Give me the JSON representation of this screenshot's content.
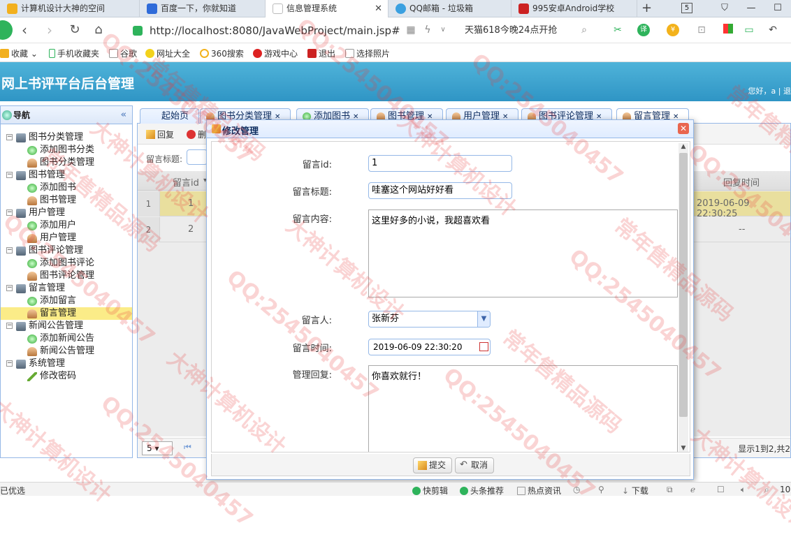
{
  "browser": {
    "tabs": [
      {
        "label": "计算机设计大神的空间",
        "color": "#f2b01e"
      },
      {
        "label": "百度一下，你就知道",
        "color": "#2f6bd9"
      },
      {
        "label": "信息管理系统",
        "color": "#bbbbbb",
        "close": "✕"
      },
      {
        "label": "QQ邮箱 - 垃圾箱",
        "color": "#3aa0e0"
      },
      {
        "label": "995安卓Android学校",
        "color": "#cc2222"
      }
    ],
    "new_tab": "+",
    "tab_count": "5",
    "url": "http://localhost:8080/JavaWebProject/main.jsp#",
    "promo": "天猫618今晚24点开抢",
    "bookmarks": [
      "收藏",
      "手机收藏夹",
      "谷歌",
      "网址大全",
      "360搜索",
      "游戏中心",
      "退出",
      "选择照片"
    ]
  },
  "app": {
    "title": "网上书评平台后台管理",
    "welcome": "您好，a | 退"
  },
  "nav": {
    "title": "导航",
    "collapse": "«",
    "tree": [
      {
        "label": "图书分类管理",
        "level": 0,
        "icon": "folder"
      },
      {
        "label": "添加图书分类",
        "level": 1,
        "icon": "add"
      },
      {
        "label": "图书分类管理",
        "level": 1,
        "icon": "user"
      },
      {
        "label": "图书管理",
        "level": 0,
        "icon": "folder"
      },
      {
        "label": "添加图书",
        "level": 1,
        "icon": "add"
      },
      {
        "label": "图书管理",
        "level": 1,
        "icon": "user"
      },
      {
        "label": "用户管理",
        "level": 0,
        "icon": "folder"
      },
      {
        "label": "添加用户",
        "level": 1,
        "icon": "add"
      },
      {
        "label": "用户管理",
        "level": 1,
        "icon": "user"
      },
      {
        "label": "图书评论管理",
        "level": 0,
        "icon": "folder"
      },
      {
        "label": "添加图书评论",
        "level": 1,
        "icon": "add"
      },
      {
        "label": "图书评论管理",
        "level": 1,
        "icon": "user"
      },
      {
        "label": "留言管理",
        "level": 0,
        "icon": "folder"
      },
      {
        "label": "添加留言",
        "level": 1,
        "icon": "add"
      },
      {
        "label": "留言管理",
        "level": 1,
        "icon": "user",
        "selected": true
      },
      {
        "label": "新闻公告管理",
        "level": 0,
        "icon": "folder"
      },
      {
        "label": "添加新闻公告",
        "level": 1,
        "icon": "add"
      },
      {
        "label": "新闻公告管理",
        "level": 1,
        "icon": "user"
      },
      {
        "label": "系统管理",
        "level": 0,
        "icon": "folder"
      },
      {
        "label": "修改密码",
        "level": 1,
        "icon": "pen"
      }
    ]
  },
  "main_tabs": [
    "起始页",
    "图书分类管理",
    "添加图书",
    "图书管理",
    "用户管理",
    "图书评论管理",
    "留言管理"
  ],
  "grid": {
    "toolbar": {
      "reply": "回复",
      "delete": "删"
    },
    "search_label": "留言标题:",
    "headers": {
      "id": "留言id",
      "reply_time": "回复时间"
    },
    "rows": [
      {
        "num": "1",
        "id": "1",
        "reply_time": "2019-06-09 22:30:25",
        "selected": true
      },
      {
        "num": "2",
        "id": "2",
        "reply_time": "--"
      }
    ],
    "page_size": "5",
    "page_info": "显示1到2,共2"
  },
  "modal": {
    "title": "修改管理",
    "close": "✕",
    "fields": {
      "id_label": "留言id:",
      "id_value": "1",
      "title_label": "留言标题:",
      "title_value": "哇塞这个网站好好看",
      "content_label": "留言内容:",
      "content_value": "这里好多的小说，我超喜欢看",
      "person_label": "留言人:",
      "person_value": "张新芬",
      "time_label": "留言时间:",
      "time_value": "2019-06-09 22:30:20",
      "reply_label": "管理回复:",
      "reply_value": "你喜欢就行！"
    },
    "submit": "提交",
    "cancel": "取消"
  },
  "statusbar": {
    "left": "已优选",
    "items": [
      "快剪辑",
      "头条推荐",
      "热点资讯",
      "下载"
    ],
    "zoom": "10"
  },
  "watermarks": [
    "QQ:2545040457",
    "大神计算机设计",
    "常年售精品源码"
  ]
}
